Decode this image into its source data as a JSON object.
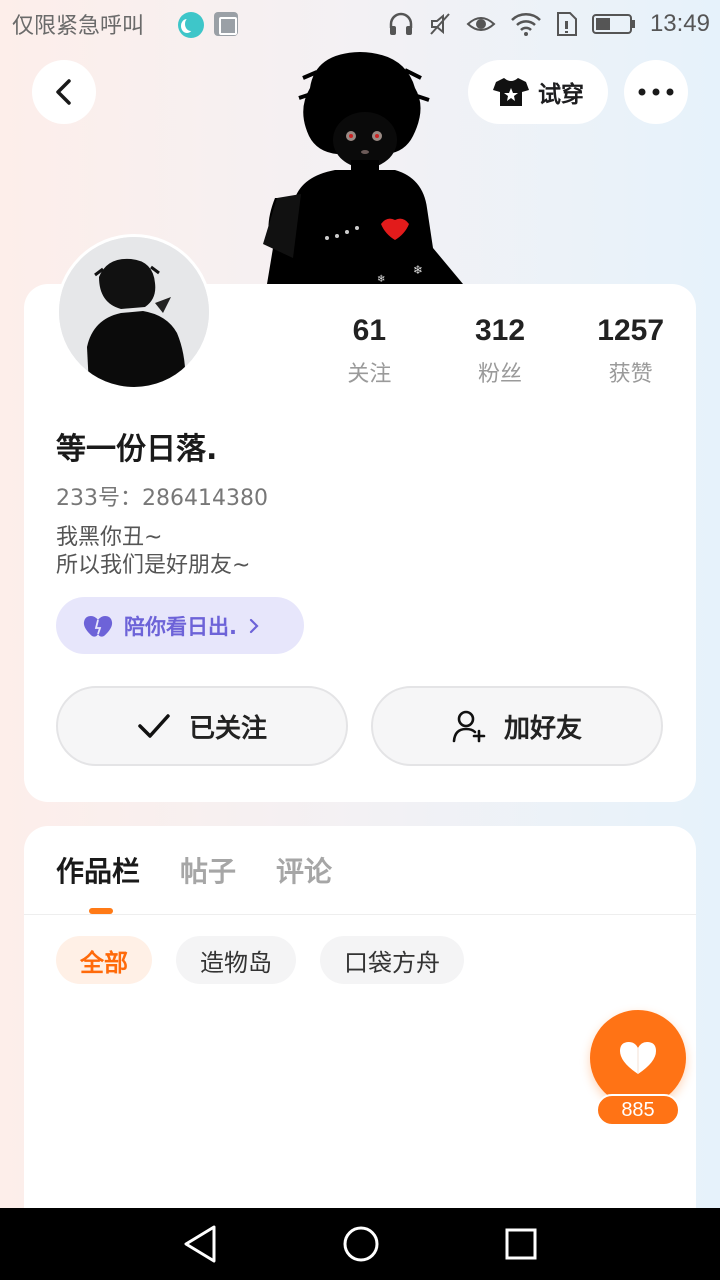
{
  "status_bar": {
    "carrier_text": "仅限紧急呼叫",
    "time": "13:49",
    "icons": [
      "moon-icon",
      "image-icon",
      "headphones-icon",
      "mute-icon",
      "eye-icon",
      "wifi-icon",
      "sim-icon",
      "battery-icon"
    ]
  },
  "header": {
    "tryon_label": "试穿"
  },
  "profile": {
    "stats": [
      {
        "value": "61",
        "label": "关注"
      },
      {
        "value": "312",
        "label": "粉丝"
      },
      {
        "value": "1257",
        "label": "获赞"
      }
    ],
    "nickname": "等一份日落.",
    "uid": "233号：286414380",
    "bio_lines": [
      "我黑你丑~",
      "所以我们是好朋友~"
    ],
    "tag_label": "陪你看日出.",
    "follow_label": "已关注",
    "add_friend_label": "加好友"
  },
  "works": {
    "tabs": [
      "作品栏",
      "帖子",
      "评论"
    ],
    "active_tab": "作品栏",
    "filters": [
      "全部",
      "造物岛",
      "口袋方舟"
    ],
    "active_filter": "全部"
  },
  "like_fab": {
    "count": "885"
  },
  "colors": {
    "accent": "#ff7315",
    "tag_bg": "#e7e6fb",
    "tag_fg": "#6d63d8"
  }
}
